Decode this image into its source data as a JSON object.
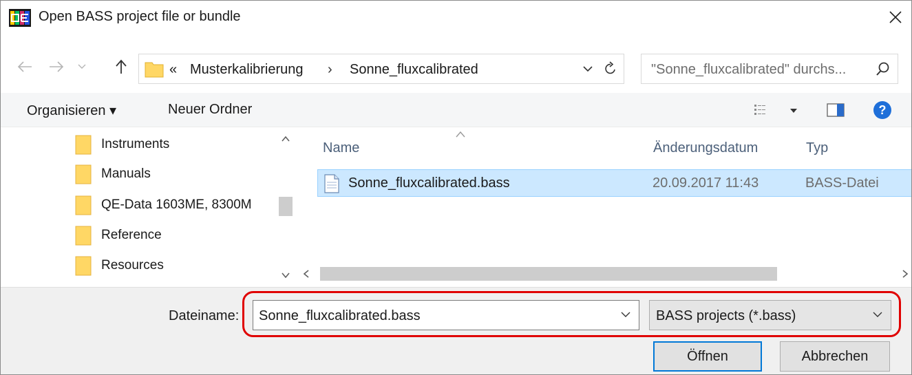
{
  "window": {
    "title": "Open BASS project file or bundle",
    "close_glyph": "✕"
  },
  "address": {
    "overflow_glyph": "«",
    "crumbs": [
      "Musterkalibrierung",
      "Sonne_fluxcalibrated"
    ],
    "search_placeholder": "\"Sonne_fluxcalibrated\" durchs..."
  },
  "toolbar": {
    "organize_label": "Organisieren ▾",
    "new_folder_label": "Neuer Ordner"
  },
  "nav": {
    "items": [
      "Instruments",
      "Manuals",
      "QE-Data 1603ME, 8300M",
      "Reference",
      "Resources"
    ]
  },
  "filelist": {
    "columns": [
      "Name",
      "Änderungsdatum",
      "Typ"
    ],
    "rows": [
      {
        "name": "Sonne_fluxcalibrated.bass",
        "date": "20.09.2017 11:43",
        "type": "BASS-Datei",
        "selected": true
      }
    ]
  },
  "bottom": {
    "filename_label": "Dateiname:",
    "filename_value": "Sonne_fluxcalibrated.bass",
    "filetype_value": "BASS projects (*.bass)",
    "open_label": "Öffnen",
    "cancel_label": "Abbrechen"
  },
  "colors": {
    "selection_bg": "#cce8ff",
    "selection_border": "#99d1ff",
    "primary_button_border": "#0078d7",
    "highlight_ring": "#e00000",
    "help_icon": "#1e6fd9",
    "folder_fill": "#ffd765"
  }
}
